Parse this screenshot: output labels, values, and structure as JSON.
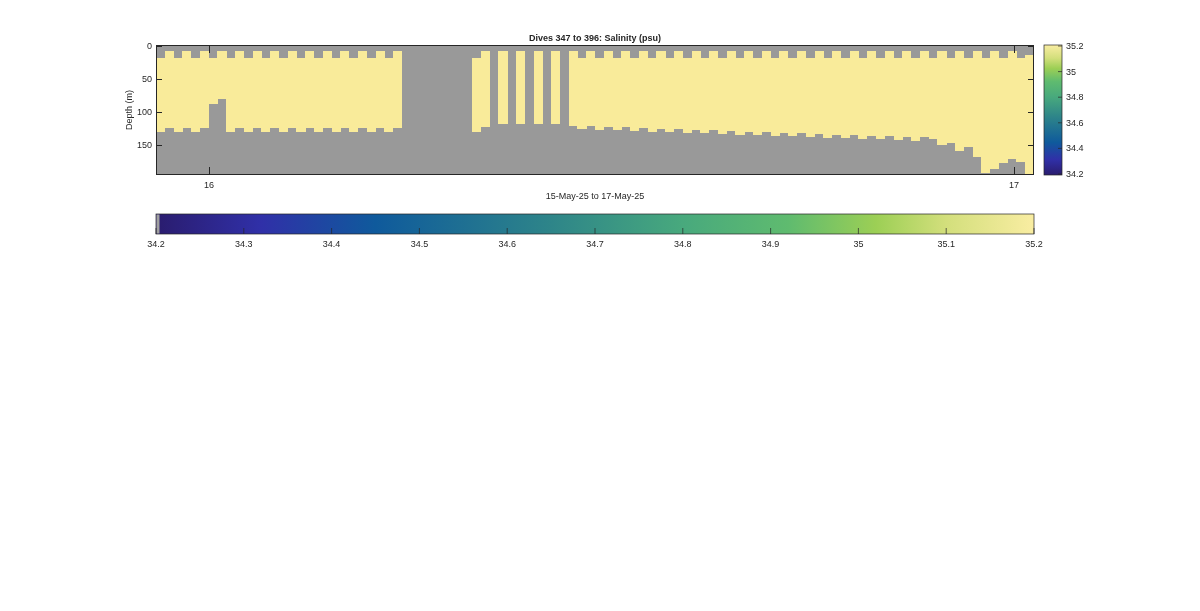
{
  "figure": {
    "title": "Dives 347 to 396: Salinity (psu)",
    "xlabel": "15-May-25 to 17-May-25",
    "ylabel": "Depth (m)",
    "xtick_labels": [
      "16",
      "17"
    ],
    "ytick_labels": [
      "0",
      "50",
      "100",
      "150"
    ],
    "side_colorbar": {
      "tick_labels": [
        "35.2",
        "35",
        "34.8",
        "34.6",
        "34.4",
        "34.2"
      ]
    },
    "bottom_colorbar": {
      "tick_labels": [
        "34.2",
        "34.3",
        "34.4",
        "34.5",
        "34.6",
        "34.7",
        "34.8",
        "34.9",
        "35",
        "35.1",
        "35.2"
      ]
    }
  }
}
